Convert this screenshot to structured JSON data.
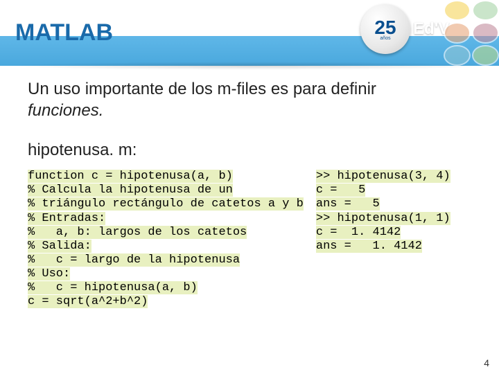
{
  "header": {
    "title": "MATLAB",
    "logo_number": "25",
    "logo_years": "años",
    "logo_text": "Ed'V"
  },
  "intro": {
    "line1": "Un uso importante de los m-files es para definir ",
    "line2_italic": "funciones."
  },
  "file_label": "hipotenusa. m:",
  "code_left": {
    "l1": "function c = hipotenusa(a, b)",
    "l2": "% Calcula la hipotenusa de un",
    "l3": "% triángulo rectángulo de catetos a y b",
    "l4": "% Entradas:",
    "l5": "%   a, b: largos de los catetos",
    "l6": "% Salida:",
    "l7": "%   c = largo de la hipotenusa",
    "l8": "% Uso:",
    "l9": "%   c = hipotenusa(a, b)",
    "l10": "c = sqrt(a^2+b^2)"
  },
  "code_right": {
    "l1": ">> hipotenusa(3, 4)",
    "l2": "c =   5",
    "l3": "ans =   5",
    "l4": ">> hipotenusa(1, 1)",
    "l5": "c =  1. 4142",
    "l6": "ans =   1. 4142"
  },
  "page_number": "4"
}
